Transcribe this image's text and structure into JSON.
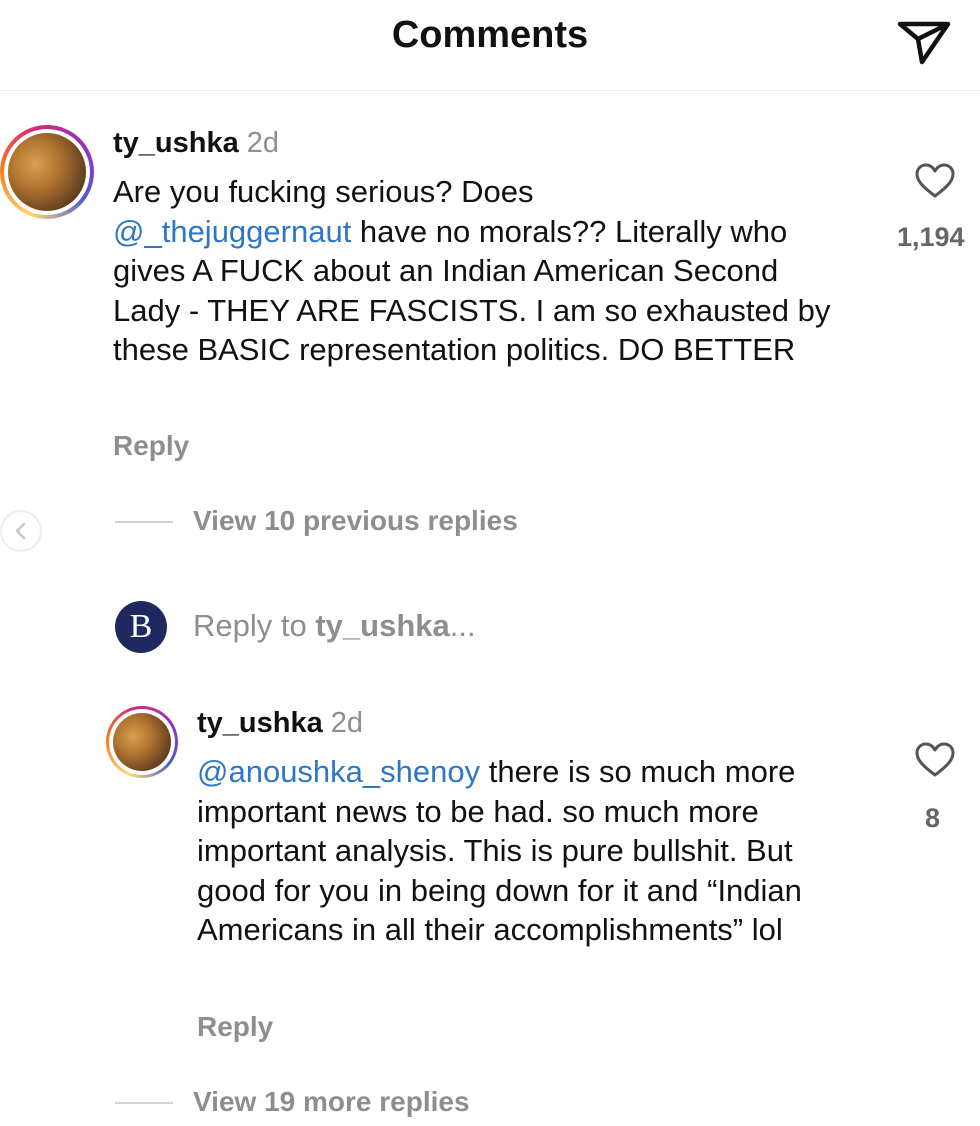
{
  "header": {
    "title": "Comments",
    "send_icon": "paper-plane-icon"
  },
  "comments": [
    {
      "username": "ty_ushka",
      "time": "2d",
      "text_line1": "Are you fucking serious? Does",
      "mention": "@_thejuggernaut",
      "text_after_mention": " have no morals?? Literally who gives A FUCK about an Indian American Second Lady - THEY ARE FASCISTS. I am so exhausted by these BASIC representation politics. DO BETTER",
      "reply_label": "Reply",
      "likes": "1,194"
    },
    {
      "username": "ty_ushka",
      "time": "2d",
      "mention": "@anoushka_shenoy",
      "text_after_mention": " there is so much more important news to be had. so much more important analysis. This is pure bullshit. But good for you in being down for it and “Indian Americans in all their accomplishments” lol",
      "reply_label": "Reply",
      "likes": "8"
    }
  ],
  "view_previous_replies": "View 10 previous replies",
  "reply_composer": {
    "avatar_letter": "B",
    "prefix": "Reply to ",
    "username": "ty_ushka",
    "ellipsis": "..."
  },
  "view_more_replies": "View 19 more replies",
  "colors": {
    "mention": "#2f77c6",
    "muted": "#8e8e8e",
    "reply_avatar": "#1f2860"
  }
}
